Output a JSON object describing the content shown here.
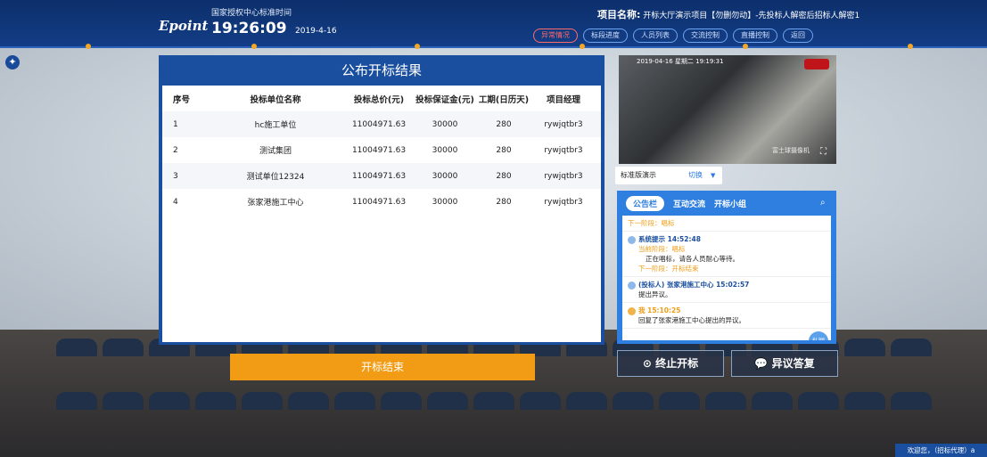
{
  "header": {
    "logo": "Epoint",
    "time_label": "国家授权中心标准时间",
    "time": "19:26:09",
    "date": "2019-4-16",
    "project_label": "项目名称:",
    "project_name": "开标大厅演示项目【勿删勿动】-先投标人解密后招标人解密1",
    "buttons": [
      "异常情况",
      "标段进度",
      "人员列表",
      "交流控制",
      "直播控制",
      "返回"
    ]
  },
  "results": {
    "title": "公布开标结果",
    "columns": [
      "序号",
      "投标单位名称",
      "投标总价(元)",
      "投标保证金(元)",
      "工期(日历天)",
      "项目经理"
    ],
    "rows": [
      [
        "1",
        "hc施工单位",
        "11004971.63",
        "30000",
        "280",
        "rywjqtbr3"
      ],
      [
        "2",
        "测试集团",
        "11004971.63",
        "30000",
        "280",
        "rywjqtbr3"
      ],
      [
        "3",
        "测试单位12324",
        "11004971.63",
        "30000",
        "280",
        "rywjqtbr3"
      ],
      [
        "4",
        "张家港施工中心",
        "11004971.63",
        "30000",
        "280",
        "rywjqtbr3"
      ]
    ],
    "end_button": "开标结束"
  },
  "video": {
    "stamp": "2019-04-16 星期二 19:19:31",
    "camera": "富士球摄像机",
    "fullscreen_icon": "expand-icon"
  },
  "selector": {
    "label": "标准版演示",
    "action": "切换"
  },
  "chat": {
    "tabs": [
      "公告栏",
      "互动交流",
      "开标小组"
    ],
    "messages": [
      {
        "who": "",
        "lines": [
          "下一阶段：唱标"
        ]
      },
      {
        "who": "系统提示 14:52:48",
        "lines": [
          "当前阶段：唱标",
          "正在唱标，请各人员耐心等待。",
          "下一阶段：开标结束"
        ]
      },
      {
        "who": "(投标人) 张家港施工中心 15:02:57",
        "lines": [
          "提出异议。"
        ]
      },
      {
        "who": "我 15:10:25",
        "lines": [
          "回复了张家港施工中心提出的异议。"
        ]
      }
    ],
    "private_button": "私聊"
  },
  "actions": {
    "stop": "终止开标",
    "objection": "异议答复"
  },
  "footer": {
    "welcome": "欢迎您，（招标代理）a"
  },
  "colors": {
    "header_bg": "#123d86",
    "panel_blue": "#1a4f9f",
    "accent_orange": "#f19c14",
    "chat_blue": "#2f7fe0"
  }
}
